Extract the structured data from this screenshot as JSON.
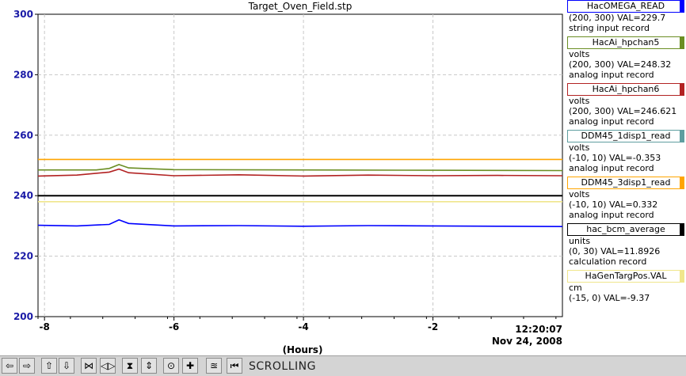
{
  "chart_data": {
    "type": "line",
    "title": "Target_Oven_Field.stp",
    "xlabel": "(Hours)",
    "xlim": [
      -8.1,
      0.0
    ],
    "ylim": [
      200,
      300
    ],
    "x_ticks": [
      -8,
      -6,
      -4,
      -2
    ],
    "x_tick_labels": [
      "-8",
      "-6",
      "-4",
      "-2"
    ],
    "x_end_time": "12:20:07",
    "x_end_date": "Nov 24, 2008",
    "y_ticks": [
      200,
      220,
      240,
      260,
      280,
      300
    ],
    "y_tick_labels": [
      "200",
      "220",
      "240",
      "260",
      "280",
      "300"
    ],
    "grid": true,
    "legend_position": "right",
    "series": [
      {
        "name": "HacOMEGA_READ",
        "color": "#0000ff",
        "range": "(200, 300)",
        "val": "229.7",
        "type": "string input record",
        "x": [
          -8.1,
          -7.5,
          -7.0,
          -6.85,
          -6.7,
          -6.0,
          -5.0,
          -4.0,
          -3.0,
          -2.0,
          -1.0,
          0.0
        ],
        "y": [
          230.2,
          230.0,
          230.5,
          232.0,
          230.8,
          230.0,
          230.1,
          229.9,
          230.1,
          230.0,
          229.9,
          229.8
        ]
      },
      {
        "name": "HacAi_hpchan5",
        "unit": "volts",
        "color": "#6b8e23",
        "range": "(200, 300)",
        "val": "248.32",
        "type": "analog input record",
        "x": [
          -8.1,
          -7.2,
          -7.0,
          -6.85,
          -6.7,
          -6.0,
          -4.0,
          -2.0,
          0.0
        ],
        "y": [
          248.5,
          248.5,
          249.0,
          250.3,
          249.2,
          248.6,
          248.5,
          248.4,
          248.3
        ]
      },
      {
        "name": "HacAi_hpchan6",
        "unit": "volts",
        "color": "#b22222",
        "range": "(200, 300)",
        "val": "246.621",
        "type": "analog input record",
        "x": [
          -8.1,
          -7.5,
          -7.0,
          -6.85,
          -6.7,
          -6.0,
          -5.0,
          -4.0,
          -3.0,
          -2.0,
          -1.0,
          0.0
        ],
        "y": [
          246.5,
          246.8,
          247.8,
          248.8,
          247.6,
          246.6,
          246.9,
          246.5,
          246.8,
          246.6,
          246.7,
          246.6
        ]
      },
      {
        "name": "DDM45_1disp1_read",
        "unit": "volts",
        "color": "#5f9ea0",
        "range": "(-10, 10)",
        "val": "-0.353",
        "type": "analog input record",
        "x": [],
        "y": []
      },
      {
        "name": "DDM45_3disp1_read",
        "unit": "volts",
        "color": "#ffa500",
        "range": "(-10, 10)",
        "val": "0.332",
        "type": "analog input record",
        "x": [
          -8.1,
          0.0
        ],
        "y": [
          252,
          252
        ]
      },
      {
        "name": "hac_bcm_average",
        "unit": "units",
        "color": "#000000",
        "range": "(0, 30)",
        "val": "11.8926",
        "type": "calculation record",
        "x": [
          -8.1,
          0.0
        ],
        "y": [
          240,
          240
        ]
      },
      {
        "name": "HaGenTargPos.VAL",
        "unit": "cm",
        "color": "#f0e68c",
        "range": "(-15, 0)",
        "val": "-9.37",
        "x": [
          -8.1,
          0.0
        ],
        "y": [
          238,
          238
        ]
      }
    ]
  },
  "legend": [
    {
      "name": "HacOMEGA_READ",
      "color": "#0000ff",
      "lines": [
        "(200, 300) VAL=229.7",
        "string input record"
      ]
    },
    {
      "name": "HacAi_hpchan5",
      "color": "#6b8e23",
      "lines": [
        "volts",
        "(200, 300) VAL=248.32",
        "analog input record"
      ]
    },
    {
      "name": "HacAi_hpchan6",
      "color": "#b22222",
      "lines": [
        "volts",
        "(200, 300) VAL=246.621",
        "analog input record"
      ]
    },
    {
      "name": "DDM45_1disp1_read",
      "color": "#5f9ea0",
      "lines": [
        "volts",
        "(-10, 10) VAL=-0.353",
        "analog input record"
      ]
    },
    {
      "name": "DDM45_3disp1_read",
      "color": "#ffa500",
      "lines": [
        "volts",
        "(-10, 10) VAL=0.332",
        "analog input record"
      ]
    },
    {
      "name": "hac_bcm_average",
      "color": "#000000",
      "lines": [
        "units",
        "(0, 30) VAL=11.8926",
        "calculation record"
      ]
    },
    {
      "name": "HaGenTargPos.VAL",
      "color": "#f0e68c",
      "lines": [
        "cm",
        "(-15, 0) VAL=-9.37"
      ]
    }
  ],
  "toolbar": {
    "buttons": [
      {
        "name": "scroll-left-button",
        "glyph": "⇦"
      },
      {
        "name": "scroll-right-button",
        "glyph": "⇨"
      },
      {
        "name": "scroll-up-button",
        "glyph": "⇧"
      },
      {
        "name": "scroll-down-button",
        "glyph": "⇩"
      },
      {
        "name": "expand-horizontal-button",
        "glyph": "⋈"
      },
      {
        "name": "compress-horizontal-button",
        "glyph": "◁▷"
      },
      {
        "name": "expand-vertical-button",
        "glyph": "⧗"
      },
      {
        "name": "compress-vertical-button",
        "glyph": "⇕"
      },
      {
        "name": "zoom-out-button",
        "glyph": "⊙"
      },
      {
        "name": "zoom-in-button",
        "glyph": "✚"
      },
      {
        "name": "autoscale-button",
        "glyph": "≊"
      },
      {
        "name": "scroll-mode-button",
        "glyph": "⏮"
      }
    ],
    "mode_label": "SCROLLING"
  }
}
